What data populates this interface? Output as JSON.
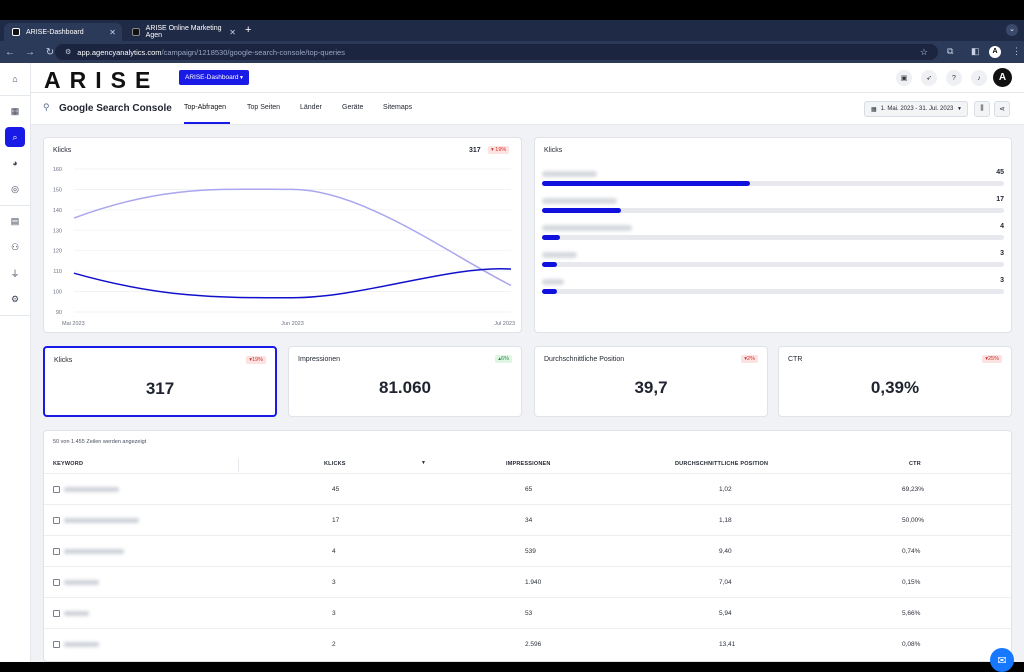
{
  "browser": {
    "tabs": [
      {
        "label": "ARISE-Dashboard",
        "active": true
      },
      {
        "label": "ARISE Online Marketing Agen",
        "active": false
      }
    ],
    "url_host": "app.agencyanalytics.com",
    "url_path": "/campaign/1218530/google-search-console/top-queries",
    "profile_initial": "A"
  },
  "header": {
    "logo": "ARISE",
    "dashboard_select": "ARISE-Dashboard",
    "avatar_initial": "A"
  },
  "subnav": {
    "title": "Google Search Console",
    "tabs": [
      "Top-Abfragen",
      "Top Seiten",
      "Länder",
      "Geräte",
      "Sitemaps"
    ],
    "active_tab": "Top-Abfragen",
    "date_range": "1. Mai. 2023 - 31. Jul. 2023"
  },
  "line_chart_card": {
    "title": "Klicks",
    "total": "317",
    "change": "19%",
    "change_dir": "down"
  },
  "chart_data": [
    {
      "type": "line",
      "title": "Klicks",
      "x": [
        "Mai 2023",
        "Jun 2023",
        "Jul 2023"
      ],
      "ylim": [
        90,
        160
      ],
      "yticks": [
        90,
        100,
        110,
        120,
        130,
        140,
        150,
        160
      ],
      "series": [
        {
          "color": "#a9a6ee",
          "values": [
            136,
            150,
            103
          ]
        },
        {
          "color": "#1111cc",
          "values": [
            109,
            97,
            111
          ]
        }
      ],
      "grid": true
    },
    {
      "type": "bar",
      "title": "Klicks",
      "orientation": "horizontal",
      "values": [
        45,
        17,
        4,
        3,
        3
      ],
      "max": 100
    }
  ],
  "bar_card": {
    "title": "Klicks"
  },
  "kpis": [
    {
      "label": "Klicks",
      "value": "317",
      "change": "19%",
      "dir": "down"
    },
    {
      "label": "Impressionen",
      "value": "81.060",
      "change": "6%",
      "dir": "up"
    },
    {
      "label": "Durchschnittliche Position",
      "value": "39,7",
      "change": "2%",
      "dir": "down"
    },
    {
      "label": "CTR",
      "value": "0,39%",
      "change": "25%",
      "dir": "down"
    }
  ],
  "table": {
    "info": "50 von 1.455 Zeilen werden angezeigt",
    "headers": [
      "KEYWORD",
      "KLICKS",
      "IMPRESSIONEN",
      "DURCHSCHNITTLICHE POSITION",
      "CTR"
    ],
    "rows": [
      {
        "klicks": "45",
        "impressionen": "65",
        "position": "1,02",
        "ctr": "69,23%"
      },
      {
        "klicks": "17",
        "impressionen": "34",
        "position": "1,18",
        "ctr": "50,00%"
      },
      {
        "klicks": "4",
        "impressionen": "539",
        "position": "9,40",
        "ctr": "0,74%"
      },
      {
        "klicks": "3",
        "impressionen": "1.940",
        "position": "7,04",
        "ctr": "0,15%"
      },
      {
        "klicks": "3",
        "impressionen": "53",
        "position": "5,94",
        "ctr": "5,66%"
      },
      {
        "klicks": "2",
        "impressionen": "2.596",
        "position": "13,41",
        "ctr": "0,08%"
      }
    ]
  },
  "colors": {
    "accent": "#1a1ae6",
    "line_light": "#a9a6ee",
    "line_dark": "#1111cc"
  }
}
